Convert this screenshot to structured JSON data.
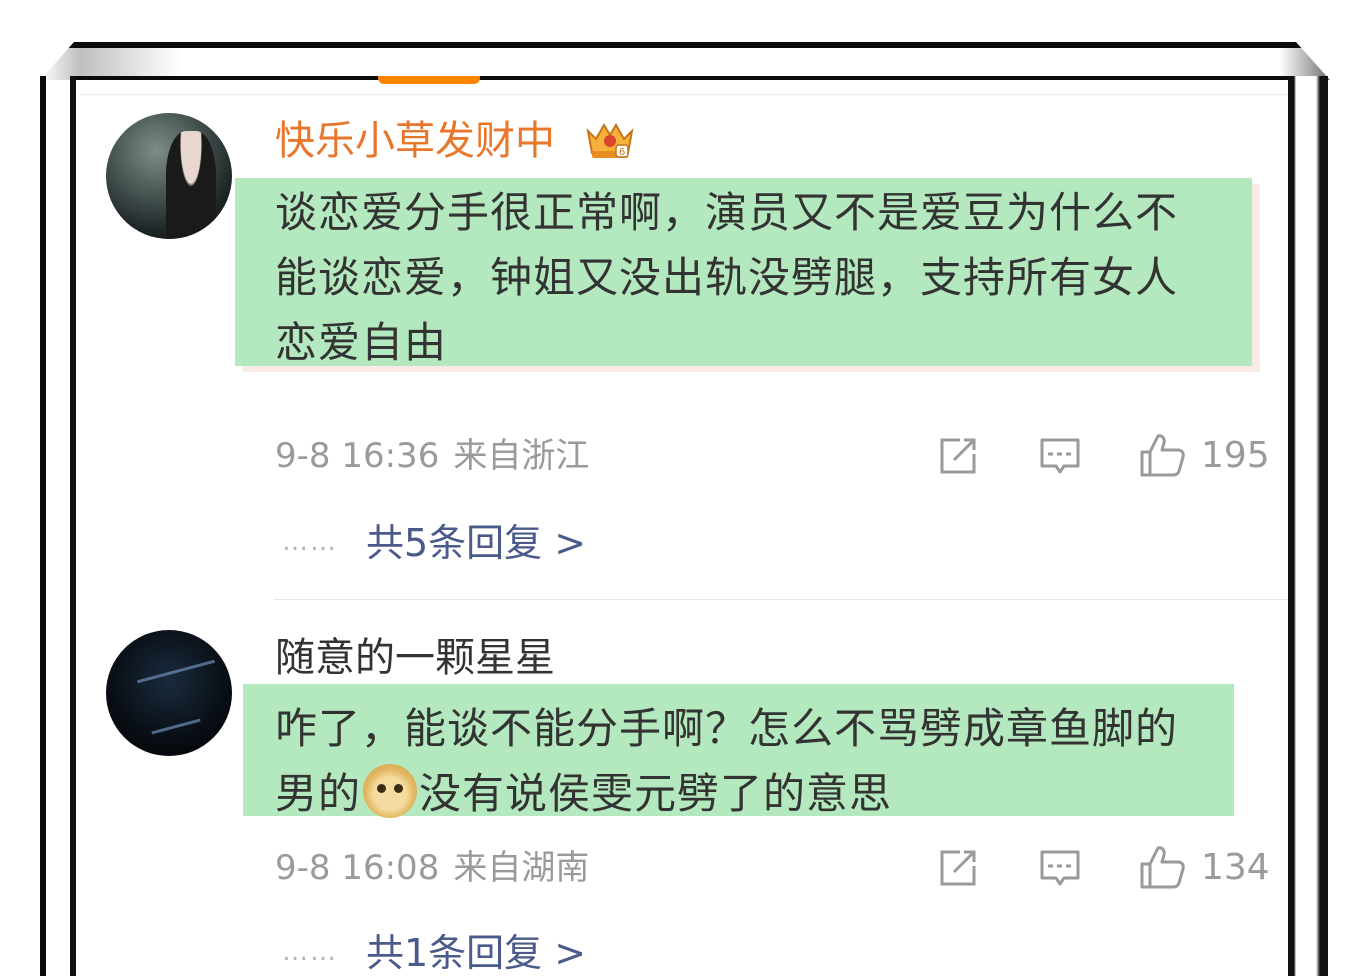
{
  "comments": [
    {
      "username": "快乐小草发财中",
      "text_lines": [
        "谈恋爱分手很正常啊，演员又不是爱豆为什么不",
        "能谈恋爱，钟姐又没出轨没劈腿，支持所有女人",
        "恋爱自由"
      ],
      "time": "9-8 16:36",
      "location": "来自浙江",
      "likes": "195",
      "replies": "共5条回复 >"
    },
    {
      "username": "随意的一颗星星",
      "text_line_1": "咋了，能谈不能分手啊？怎么不骂劈成章鱼脚的",
      "text_line_2_before": "男的",
      "text_line_2_after": "没有说侯雯元劈了的意思",
      "time": "9-8 16:08",
      "location": "来自湖南",
      "likes": "134",
      "replies": "共1条回复 >"
    }
  ],
  "reply_dots": "……",
  "icons": [
    "crown-badge-icon",
    "doge-emoji-icon",
    "share-icon",
    "comment-icon",
    "like-icon"
  ],
  "colors": {
    "username_vip": "#e8762b",
    "username": "#333333",
    "highlight": "#b4e8be",
    "meta": "#9a9a9a",
    "reply_link": "#4a5a8a",
    "accent": "#ff8200"
  }
}
